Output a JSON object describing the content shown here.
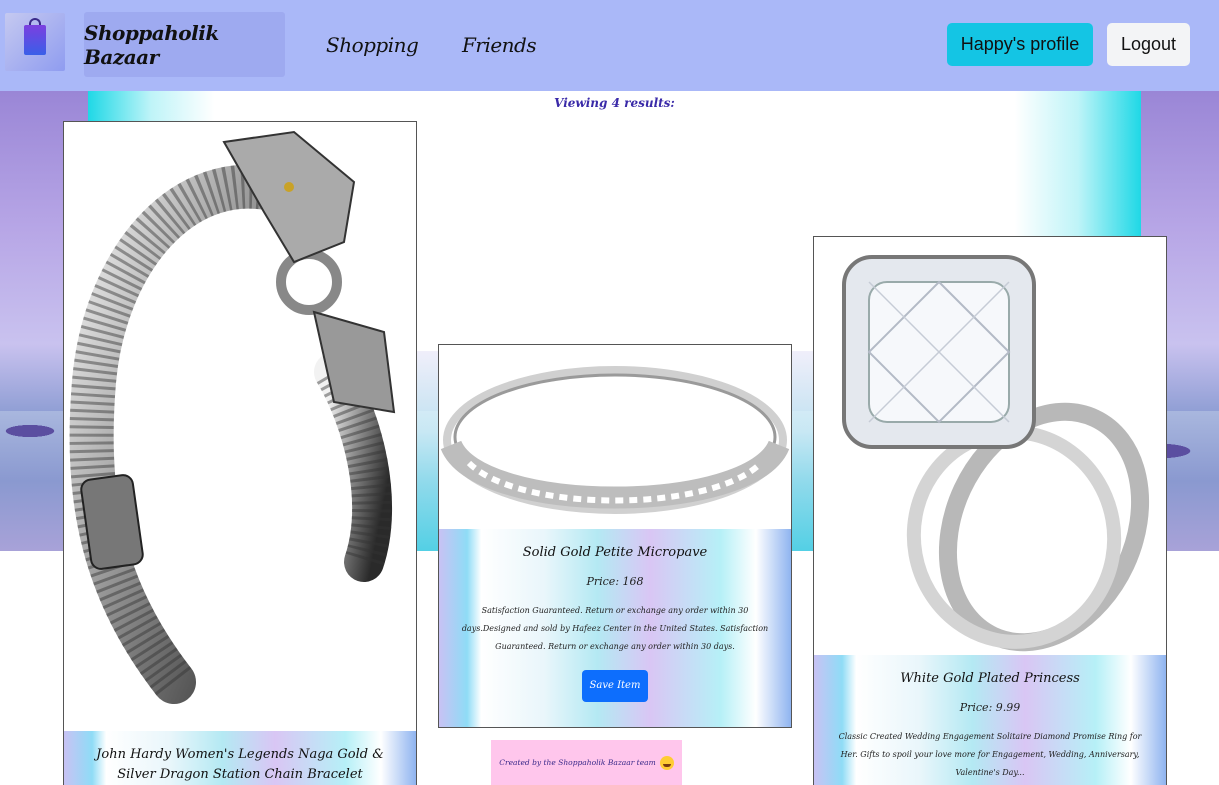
{
  "nav": {
    "brand": "Shoppaholik Bazaar",
    "links": [
      "Shopping",
      "Friends"
    ],
    "profile_button": "Happy's profile",
    "logout_button": "Logout",
    "logo_icon": "shopping-bag-logo-icon"
  },
  "results_text": "Viewing 4 results:",
  "cards": [
    {
      "title": "John Hardy Women's Legends Naga Gold & Silver Dragon Station Chain Bracelet",
      "image_icon": "dragon-bracelet-image"
    },
    {
      "title": "Solid Gold Petite Micropave",
      "price": "Price: 168",
      "description": "Satisfaction Guaranteed. Return or exchange any order within 30 days.Designed and sold by Hafeez Center in the United States. Satisfaction Guaranteed. Return or exchange any order within 30 days.",
      "save_button": "Save Item",
      "image_icon": "silver-band-ring-image"
    },
    {
      "title": "White Gold Plated Princess",
      "price": "Price: 9.99",
      "description": "Classic Created Wedding Engagement Solitaire Diamond Promise Ring for Her. Gifts to spoil your love more for Engagement, Wedding, Anniversary, Valentine's Day...",
      "image_icon": "princess-cut-ring-image"
    }
  ],
  "footer": {
    "text": "Created by the Shoppaholik Bazaar team",
    "emoji_icon": "grinning-face-icon"
  },
  "colors": {
    "navbar": "#aab8f8",
    "profile_button": "#14c5e4",
    "save_button": "#0d6efd",
    "footer_bg": "#ffc6ec"
  }
}
